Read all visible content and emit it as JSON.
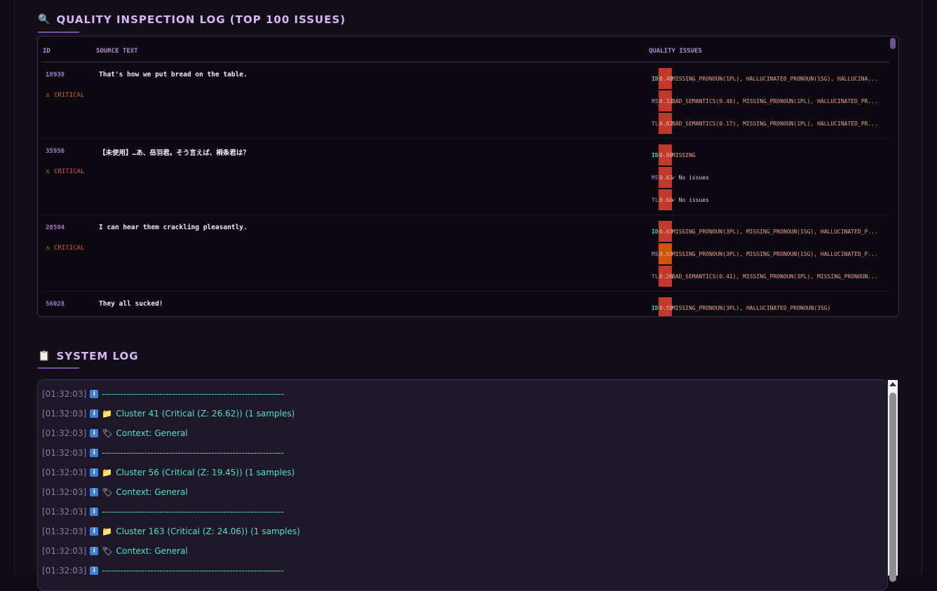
{
  "inspection": {
    "title": "QUALITY INSPECTION LOG (TOP 100 ISSUES)",
    "title_icon": "magnifier-icon",
    "columns": {
      "id": "ID",
      "source": "SOURCE TEXT",
      "issues": "QUALITY ISSUES"
    },
    "rows": [
      {
        "id": "18938",
        "status": "CRITICAL",
        "source": "That's how we put bread on the table.",
        "issues": [
          {
            "tag": "ID",
            "score": "0.48",
            "text": "MISSING_PRONOUN(1PL), HALLUCINATED_PRONOUN(1SG), HALLUCINA...",
            "bar": "red"
          },
          {
            "tag": "MS",
            "score": "0.31",
            "text": "BAD_SEMANTICS(0.46), MISSING_PRONOUN(1PL), HALLUCINATED_PR...",
            "bar": "red"
          },
          {
            "tag": "TL",
            "score": "0.02",
            "text": "BAD_SEMANTICS(0.17), MISSING_PRONOUN(1PL), HALLUCINATED_PR...",
            "bar": "red"
          }
        ]
      },
      {
        "id": "35956",
        "status": "CRITICAL",
        "source": "【未使用】…あ、岳羽君。そう言えば、桐条君は？",
        "issues": [
          {
            "tag": "ID",
            "score": "0.00",
            "text": "MISSING",
            "bar": "red"
          },
          {
            "tag": "MS",
            "score": "0.63",
            "text": "✓ No issues",
            "bar": "red",
            "ok": true
          },
          {
            "tag": "TL",
            "score": "0.60",
            "text": "✓ No issues",
            "bar": "red",
            "ok": true
          }
        ]
      },
      {
        "id": "20594",
        "status": "CRITICAL",
        "source": "I can hear them crackling pleasantly.",
        "issues": [
          {
            "tag": "ID",
            "score": "0.63",
            "text": "MISSING_PRONOUN(3PL), MISSING_PRONOUN(1SG), HALLUCINATED_P...",
            "bar": "red"
          },
          {
            "tag": "MS",
            "score": "0.65",
            "text": "MISSING_PRONOUN(3PL), MISSING_PRONOUN(1SG), HALLUCINATED_P...",
            "bar": "orange"
          },
          {
            "tag": "TL",
            "score": "0.26",
            "text": "BAD_SEMANTICS(0.41), MISSING_PRONOUN(3PL), MISSING_PRONOUN...",
            "bar": "red"
          }
        ]
      },
      {
        "id": "56028",
        "status": "",
        "source": "They all sucked!",
        "issues": [
          {
            "tag": "ID",
            "score": "0.59",
            "text": "MISSING_PRONOUN(3PL), HALLUCINATED_PRONOUN(3SG)",
            "bar": "red"
          }
        ]
      }
    ]
  },
  "system_log": {
    "title": "SYSTEM LOG",
    "title_icon": "clipboard-icon",
    "lines": [
      {
        "time": "[01:32:03]",
        "icon": "",
        "text": "------------------------------------------------------------"
      },
      {
        "time": "[01:32:03]",
        "icon": "📁",
        "text": "Cluster 41 (Critical (Z: 26.62)) (1 samples)"
      },
      {
        "time": "[01:32:03]",
        "icon": "🏷",
        "text": "Context: General"
      },
      {
        "time": "[01:32:03]",
        "icon": "",
        "text": "------------------------------------------------------------"
      },
      {
        "time": "[01:32:03]",
        "icon": "📁",
        "text": "Cluster 56 (Critical (Z: 19.45)) (1 samples)"
      },
      {
        "time": "[01:32:03]",
        "icon": "🏷",
        "text": "Context: General"
      },
      {
        "time": "[01:32:03]",
        "icon": "",
        "text": "------------------------------------------------------------"
      },
      {
        "time": "[01:32:03]",
        "icon": "📁",
        "text": "Cluster 163 (Critical (Z: 24.06)) (1 samples)"
      },
      {
        "time": "[01:32:03]",
        "icon": "🏷",
        "text": "Context: General"
      },
      {
        "time": "[01:32:03]",
        "icon": "",
        "text": "------------------------------------------------------------"
      }
    ]
  },
  "colors": {
    "accent": "#d8b7f2",
    "critical": "#e0553c",
    "bar_red": "#c0392b",
    "bar_orange": "#d35400",
    "log_text": "#4fe0d0"
  }
}
